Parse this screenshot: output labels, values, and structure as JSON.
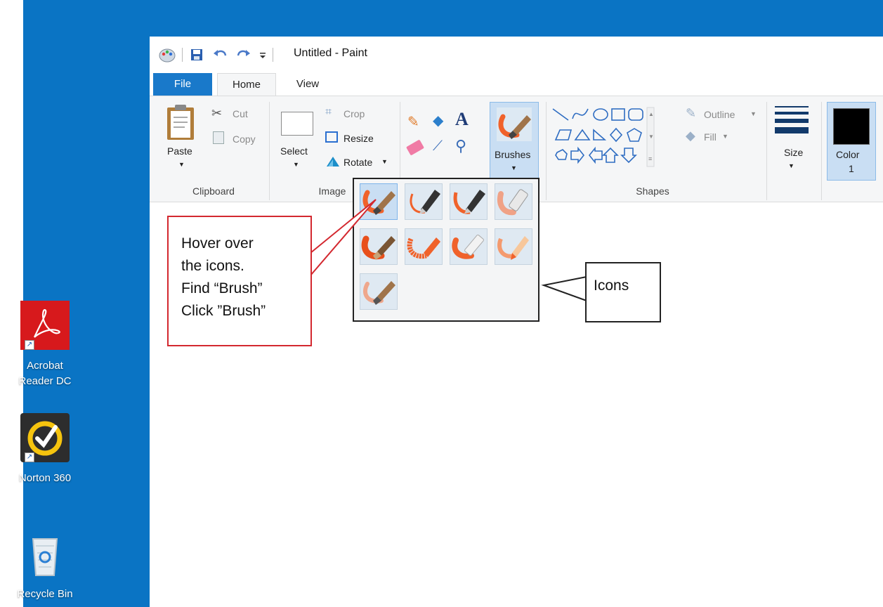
{
  "window": {
    "title": "Untitled - Paint"
  },
  "tabs": [
    {
      "label": "File"
    },
    {
      "label": "Home"
    },
    {
      "label": "View"
    }
  ],
  "clipboard": {
    "paste": "Paste",
    "cut": "Cut",
    "copy": "Copy",
    "group": "Clipboard"
  },
  "image": {
    "select": "Select",
    "crop": "Crop",
    "resize": "Resize",
    "rotate": "Rotate",
    "group": "Image"
  },
  "brushes": {
    "label": "Brushes"
  },
  "shapes": {
    "outline": "Outline",
    "fill": "Fill",
    "group": "Shapes"
  },
  "size": {
    "label": "Size"
  },
  "color": {
    "label": "Color",
    "number": "1",
    "value": "#000000"
  },
  "brush_flyout": {
    "items": [
      "brush",
      "calligraphy-brush-1",
      "calligraphy-brush-2",
      "airbrush",
      "oil-brush",
      "crayon",
      "marker",
      "natural-pencil",
      "watercolor-brush"
    ],
    "selected_index": 0
  },
  "callouts": {
    "instruction": [
      "Hover over",
      "the icons.",
      "Find “Brush”",
      "Click ”Brush”"
    ],
    "icons": "Icons"
  },
  "desktop_icons": [
    {
      "label_line1": "Acrobat",
      "label_line2": "Reader DC"
    },
    {
      "label_line1": "Norton 360"
    },
    {
      "label_line1": "Recycle Bin"
    }
  ],
  "accent_colors": {
    "desktop": "#0a74c4",
    "file_tab": "#1979ca",
    "callout_border": "#d3282f",
    "brush_orange": "#f0622b"
  }
}
